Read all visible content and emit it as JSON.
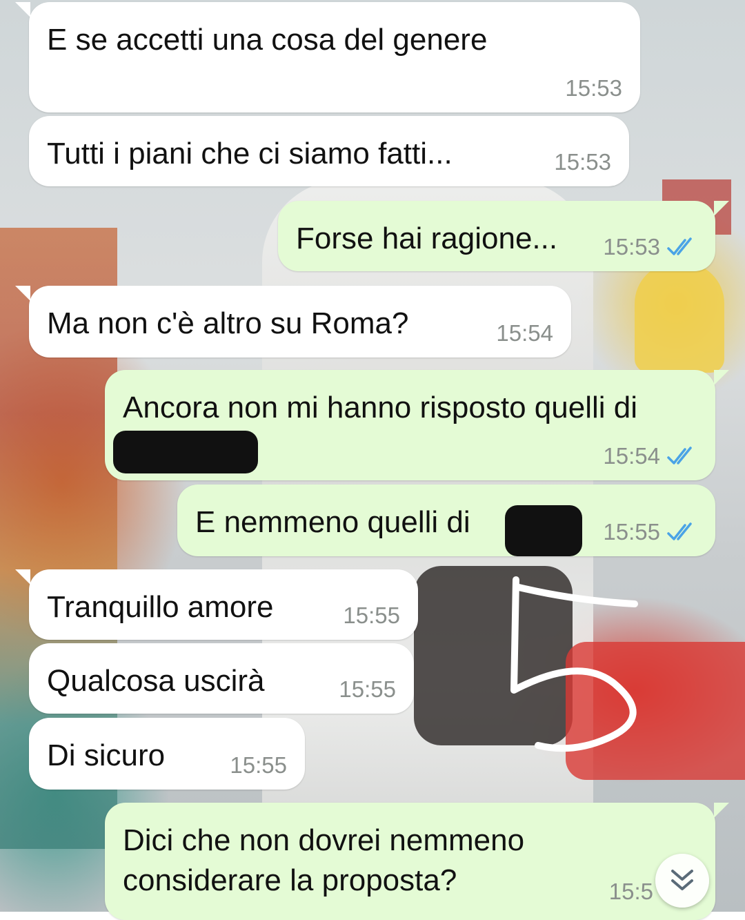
{
  "messages": [
    {
      "dir": "in",
      "text": "E se accetti una cosa del genere",
      "time": "15:53"
    },
    {
      "dir": "in",
      "text": "Tutti i piani che ci siamo fatti...",
      "time": "15:53"
    },
    {
      "dir": "out",
      "text": "Forse hai ragione...",
      "time": "15:53",
      "status": "read"
    },
    {
      "dir": "in",
      "text": "Ma non c'è altro su Roma?",
      "time": "15:54"
    },
    {
      "dir": "out",
      "text": "Ancora non mi hanno risposto quelli di",
      "time": "15:54",
      "status": "read"
    },
    {
      "dir": "out",
      "text": "E nemmeno quelli di",
      "time": "15:55",
      "status": "read"
    },
    {
      "dir": "in",
      "text": "Tranquillo amore",
      "time": "15:55"
    },
    {
      "dir": "in",
      "text": "Qualcosa uscirà",
      "time": "15:55"
    },
    {
      "dir": "in",
      "text": "Di sicuro",
      "time": "15:55"
    },
    {
      "dir": "out",
      "text_line1": "Dici che non dovrei nemmeno",
      "text_line2": "considerare la proposta?",
      "time": "15:5"
    }
  ],
  "icons": {
    "read_receipt": "double-check-icon",
    "scroll_down": "chevron-double-down-icon"
  },
  "colors": {
    "incoming_bubble": "#ffffff",
    "outgoing_bubble": "#e4fbd5",
    "read_tick": "#4aa3e6",
    "time_text": "#8a8f8c"
  }
}
